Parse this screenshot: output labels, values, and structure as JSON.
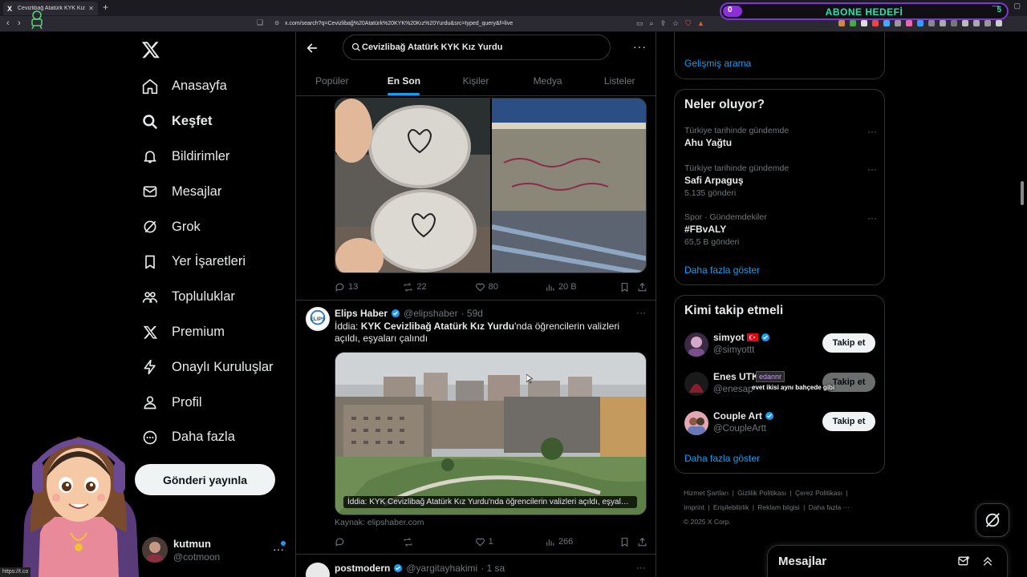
{
  "browser": {
    "tab_title": "Cevizlibağ Atatürk KYK Kız Yurdu",
    "tab_favicon": "X",
    "url": "x.com/search?q=Cevizlibağ%20Atatürk%20KYK%20Kız%20Yurdu&src=typed_query&f=live",
    "status_url": "https://t.co"
  },
  "overlay_goal": {
    "current": "0",
    "title": "ABONE HEDEFİ",
    "target": "5",
    "progress": 0
  },
  "sidebar": {
    "items": [
      {
        "label": "Anasayfa",
        "icon": "home-icon"
      },
      {
        "label": "Keşfet",
        "icon": "search-icon"
      },
      {
        "label": "Bildirimler",
        "icon": "bell-icon"
      },
      {
        "label": "Mesajlar",
        "icon": "mail-icon"
      },
      {
        "label": "Grok",
        "icon": "grok-icon"
      },
      {
        "label": "Yer İşaretleri",
        "icon": "bookmark-icon"
      },
      {
        "label": "Topluluklar",
        "icon": "communities-icon"
      },
      {
        "label": "Premium",
        "icon": "x-logo-icon"
      },
      {
        "label": "Onaylı Kuruluşlar",
        "icon": "lightning-icon"
      },
      {
        "label": "Profil",
        "icon": "person-icon"
      },
      {
        "label": "Daha fazla",
        "icon": "more-circle-icon"
      }
    ],
    "post_button": "Gönderi yayınla",
    "account": {
      "name": "kutmun",
      "handle": "@cotmoon"
    }
  },
  "search": {
    "query": "Cevizlibağ Atatürk KYK Kız Yurdu",
    "tabs": [
      "Popüler",
      "En Son",
      "Kişiler",
      "Medya",
      "Listeler"
    ],
    "active_tab": "En Son"
  },
  "tweets": [
    {
      "replies": "13",
      "reposts": "22",
      "likes": "80",
      "views": "20 B"
    },
    {
      "name": "Elips Haber",
      "handle": "@elipshaber",
      "time": "· 59d",
      "text_prefix": "İddia: ",
      "text_bold": "KYK Cevizlibağ Atatürk Kız Yurdu",
      "text_suffix": "'nda öğrencilerin valizleri açıldı, eşyaları çalındı",
      "card_caption": "İddia: KYK Cevizlibağ Atatürk Kız Yurdu'nda öğrencilerin valizleri açıldı, eşyaları ...",
      "source": "Kaynak: elipshaber.com",
      "replies": "",
      "reposts": "",
      "likes": "1",
      "views": "266"
    },
    {
      "name": "postmodern",
      "handle": "@yargitayhakimi",
      "time": "· 1 sa"
    }
  ],
  "right": {
    "advanced_search": "Gelişmiş arama",
    "trends_title": "Neler oluyor?",
    "trends": [
      {
        "context": "Türkiye tarihinde gündemde",
        "name": "Ahu Yağtu",
        "count": ""
      },
      {
        "context": "Türkiye tarihinde gündemde",
        "name": "Safi Arpaguş",
        "count": "5.135 gönderi"
      },
      {
        "context": "Spor · Gündemdekiler",
        "name": "#FBvALY",
        "count": "65,5 B gönderi"
      }
    ],
    "show_more": "Daha fazla göster",
    "wtf_title": "Kimi takip etmeli",
    "wtf": [
      {
        "name": "simyot",
        "handle": "@simyottt",
        "button": "Takip et"
      },
      {
        "name": "Enes UTK",
        "handle": "@enesap",
        "button": "Takip et"
      },
      {
        "name": "Couple Art",
        "handle": "@CoupleArtt",
        "button": "Takip et"
      }
    ],
    "footer": [
      "Hizmet Şartları",
      "Gizlilik Politikası",
      "Çerez Politikası",
      "Imprint",
      "Erişilebilirlik",
      "Reklam bilgisi",
      "Daha fazla ···",
      "© 2025 X Corp."
    ]
  },
  "chat_overlay": {
    "user": "edannr",
    "message": "evet ikisi aynı bahçede gibi"
  },
  "messages_drawer": {
    "title": "Mesajlar"
  },
  "colors": {
    "accent": "#1d9bf0",
    "background": "#000000",
    "goal_purple": "#8b2fd6",
    "goal_green": "#2de0ad"
  }
}
